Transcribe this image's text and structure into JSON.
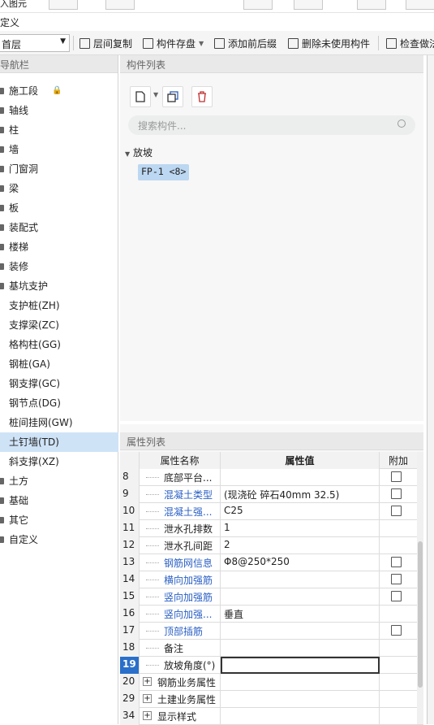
{
  "top_tabs_partial": "入图元",
  "title": "定义",
  "toolbar": {
    "floor": "首层",
    "copy_floor": "层间复制",
    "save_component": "构件存盘",
    "add_prefix": "添加前后缀",
    "delete_unused": "删除未使用构件",
    "check": "检查做法"
  },
  "nav": {
    "title": "导航栏",
    "items": [
      {
        "label": "施工段"
      },
      {
        "label": "轴线"
      },
      {
        "label": "柱"
      },
      {
        "label": "墙"
      },
      {
        "label": "门窗洞"
      },
      {
        "label": "梁"
      },
      {
        "label": "板"
      },
      {
        "label": "装配式"
      },
      {
        "label": "楼梯"
      },
      {
        "label": "装修"
      },
      {
        "label": "基坑支护"
      },
      {
        "label": "支护桩(ZH)"
      },
      {
        "label": "支撑梁(ZC)"
      },
      {
        "label": "格构柱(GG)"
      },
      {
        "label": "钢桩(GA)"
      },
      {
        "label": "钢支撑(GC)"
      },
      {
        "label": "钢节点(DG)"
      },
      {
        "label": "桩间挂网(GW)"
      },
      {
        "label": "土钉墙(TD)"
      },
      {
        "label": "斜支撑(XZ)"
      },
      {
        "label": "土方"
      },
      {
        "label": "基础"
      },
      {
        "label": "其它"
      },
      {
        "label": "自定义"
      }
    ]
  },
  "components": {
    "title": "构件列表",
    "search_placeholder": "搜索构件...",
    "group": "放坡",
    "item": "FP-1 <8>"
  },
  "properties": {
    "title": "属性列表",
    "headers": {
      "name": "属性名称",
      "value": "属性值",
      "add": "附加"
    },
    "rows": [
      {
        "num": "8",
        "name": "底部平台...",
        "value": "",
        "checkbox": true
      },
      {
        "num": "9",
        "name": "混凝土类型",
        "value": "(现浇砼 碎石40mm 32.5)",
        "checkbox": true
      },
      {
        "num": "10",
        "name": "混凝土强...",
        "value": "C25",
        "checkbox": true
      },
      {
        "num": "11",
        "name": "泄水孔排数",
        "value": "1",
        "checkbox": false
      },
      {
        "num": "12",
        "name": "泄水孔间距",
        "value": "2",
        "checkbox": false
      },
      {
        "num": "13",
        "name": "钢筋网信息",
        "value": "Φ8@250*250",
        "checkbox": true
      },
      {
        "num": "14",
        "name": "横向加强筋",
        "value": "",
        "checkbox": true
      },
      {
        "num": "15",
        "name": "竖向加强筋",
        "value": "",
        "checkbox": true
      },
      {
        "num": "16",
        "name": "竖向加强...",
        "value": "垂直",
        "checkbox": false
      },
      {
        "num": "17",
        "name": "顶部插筋",
        "value": "",
        "checkbox": true
      },
      {
        "num": "18",
        "name": "备注",
        "value": "",
        "checkbox": false
      },
      {
        "num": "19",
        "name": "放坡角度(°)",
        "value": "",
        "checkbox": false
      },
      {
        "num": "20",
        "name": "钢筋业务属性",
        "value": "",
        "checkbox": false
      },
      {
        "num": "29",
        "name": "土建业务属性",
        "value": "",
        "checkbox": false
      },
      {
        "num": "34",
        "name": "显示样式",
        "value": "",
        "checkbox": false
      }
    ]
  },
  "colors": {
    "blue_text": "#2a5fc4",
    "selection": "#cfe3f7",
    "row_selected": "#2a6fc9"
  }
}
